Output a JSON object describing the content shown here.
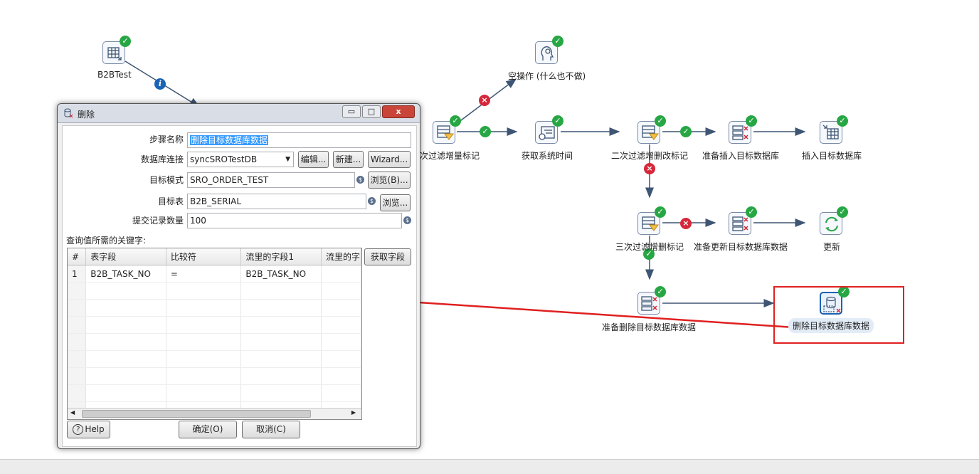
{
  "canvas": {
    "steps": {
      "b2btest": "B2BTest",
      "noop": "空操作 (什么也不做)",
      "filter1": "次过滤增量标记",
      "get_time": "获取系统时间",
      "filter2": "二次过滤增删改标记",
      "prep_insert": "准备插入目标数据库",
      "insert": "插入目标数据库",
      "filter3": "三次过滤增删标记",
      "prep_update": "准备更新目标数据库数据",
      "update": "更新",
      "prep_delete": "准备删除目标数据库数据",
      "delete": "删除目标数据库数据"
    },
    "colors": {
      "ok": "#27a744",
      "error": "#d6283a",
      "info": "#1a63b5",
      "highlight": "#e02020"
    }
  },
  "dialog": {
    "title": "删除",
    "window_buttons": {
      "minimize": "▭",
      "maximize": "□",
      "close": "x"
    },
    "fields": {
      "step_name_label": "步骤名称",
      "step_name_value": "删除目标数据库数据",
      "connection_label": "数据库连接",
      "connection_value": "syncSROTestDB",
      "edit_button": "编辑...",
      "new_button": "新建...",
      "wizard_button": "Wizard...",
      "schema_label": "目标模式",
      "schema_value": "SRO_ORDER_TEST",
      "schema_browse": "浏览(B)...",
      "table_label": "目标表",
      "table_value": "B2B_SERIAL",
      "table_browse": "浏览...",
      "commit_label": "提交记录数量",
      "commit_value": "100"
    },
    "keys_label": "查询值所需的关键字:",
    "get_fields_button": "获取字段",
    "table": {
      "headers": [
        "#",
        "表字段",
        "比较符",
        "流里的字段1",
        "流里的字"
      ],
      "rows": [
        [
          "1",
          "B2B_TASK_NO",
          "=",
          "B2B_TASK_NO",
          ""
        ]
      ]
    },
    "help_button": "Help",
    "ok_button": "确定(O)",
    "cancel_button": "取消(C)"
  }
}
